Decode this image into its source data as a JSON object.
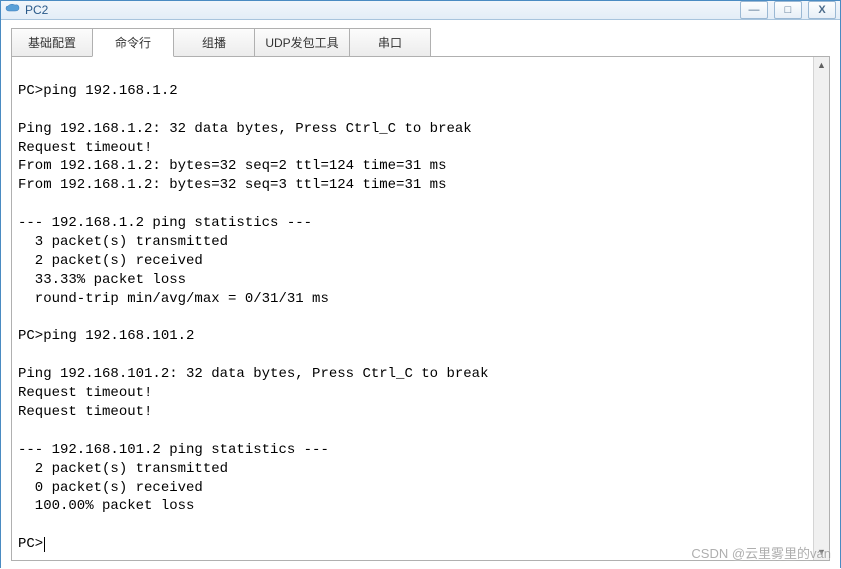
{
  "window": {
    "title": "PC2",
    "controls": {
      "minimize": "—",
      "maximize": "□",
      "close": "X"
    }
  },
  "tabs": [
    {
      "label": "基础配置",
      "active": false
    },
    {
      "label": "命令行",
      "active": true
    },
    {
      "label": "组播",
      "active": false
    },
    {
      "label": "UDP发包工具",
      "active": false,
      "wide": true
    },
    {
      "label": "串口",
      "active": false
    }
  ],
  "terminal": {
    "lines": [
      "",
      "PC>ping 192.168.1.2",
      "",
      "Ping 192.168.1.2: 32 data bytes, Press Ctrl_C to break",
      "Request timeout!",
      "From 192.168.1.2: bytes=32 seq=2 ttl=124 time=31 ms",
      "From 192.168.1.2: bytes=32 seq=3 ttl=124 time=31 ms",
      "",
      "--- 192.168.1.2 ping statistics ---",
      "  3 packet(s) transmitted",
      "  2 packet(s) received",
      "  33.33% packet loss",
      "  round-trip min/avg/max = 0/31/31 ms",
      "",
      "PC>ping 192.168.101.2",
      "",
      "Ping 192.168.101.2: 32 data bytes, Press Ctrl_C to break",
      "Request timeout!",
      "Request timeout!",
      "",
      "--- 192.168.101.2 ping statistics ---",
      "  2 packet(s) transmitted",
      "  0 packet(s) received",
      "  100.00% packet loss",
      ""
    ],
    "prompt": "PC>"
  },
  "watermark": "CSDN @云里雾里的van"
}
